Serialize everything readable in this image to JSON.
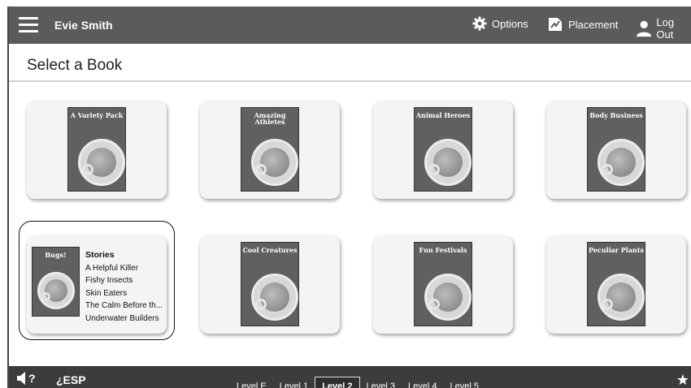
{
  "header": {
    "user_name": "Evie Smith",
    "options_label": "Options",
    "placement_label": "Placement",
    "logout_label": "Log Out"
  },
  "page": {
    "title": "Select a Book"
  },
  "books": [
    {
      "title": "A Variety Pack"
    },
    {
      "title": "Amazing Athletes"
    },
    {
      "title": "Animal Heroes"
    },
    {
      "title": "Body Business"
    },
    {
      "title": "Bugs!"
    },
    {
      "title": "Cool Creatures"
    },
    {
      "title": "Fun Festivals"
    },
    {
      "title": "Peculiar Plants"
    }
  ],
  "selected_book": {
    "heading": "Stories",
    "stories": [
      "A Helpful Killer",
      "Fishy Insects",
      "Skin Eaters",
      "The Calm Before th...",
      "Underwater Builders"
    ]
  },
  "footer": {
    "sound_label": "?",
    "esp_label": "¿ESP",
    "levels": [
      "Level E",
      "Level 1",
      "Level 2",
      "Level 3",
      "Level 4",
      "Level 5"
    ],
    "active_level": "Level 2"
  },
  "colors": {
    "topbar": "#5b5b5b",
    "bottombar": "#3c3c3c",
    "card": "#f4f4f4"
  },
  "icons": [
    "menu-icon",
    "gear-icon",
    "placement-icon",
    "user-icon",
    "speaker-icon",
    "star-icon"
  ]
}
